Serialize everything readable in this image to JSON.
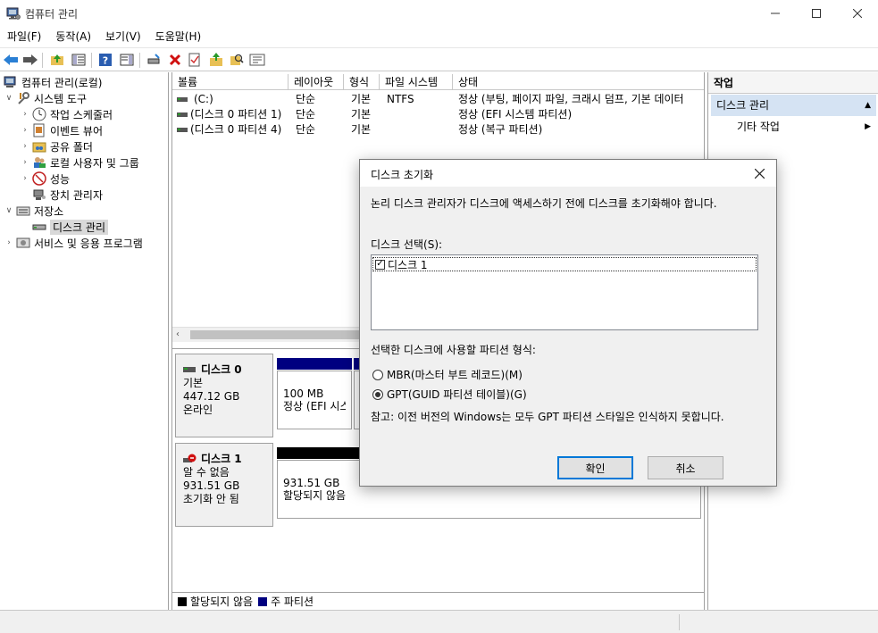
{
  "window": {
    "title": "컴퓨터 관리"
  },
  "menu": [
    "파일(F)",
    "동작(A)",
    "보기(V)",
    "도움말(H)"
  ],
  "tree": {
    "root": "컴퓨터 관리(로컬)",
    "system_tools": "시스템 도구",
    "task_scheduler": "작업 스케줄러",
    "event_viewer": "이벤트 뷰어",
    "shared_folders": "공유 폴더",
    "local_users": "로컬 사용자 및 그룹",
    "performance": "성능",
    "device_manager": "장치 관리자",
    "storage": "저장소",
    "disk_management": "디스크 관리",
    "services": "서비스 및 응용 프로그램"
  },
  "volume_table": {
    "headers": [
      "볼륨",
      "레이아웃",
      "형식",
      "파일 시스템",
      "상태"
    ],
    "rows": [
      [
        "(C:)",
        "단순",
        "기본",
        "NTFS",
        "정상 (부팅, 페이지 파일, 크래시 덤프, 기본 데이터"
      ],
      [
        "(디스크 0 파티션 1)",
        "단순",
        "기본",
        "",
        "정상 (EFI 시스템 파티션)"
      ],
      [
        "(디스크 0 파티션 4)",
        "단순",
        "기본",
        "",
        "정상 (복구 파티션)"
      ]
    ]
  },
  "disks": {
    "disk0": {
      "name": "디스크 0",
      "type": "기본",
      "size": "447.12 GB",
      "status": "온라인",
      "part_size": "100 MB",
      "part_status": "정상 (EFI 시스"
    },
    "disk1": {
      "name": "디스크 1",
      "type": "알 수 없음",
      "size": "931.51 GB",
      "status": "초기화 안 됨",
      "part_size": "931.51 GB",
      "part_status": "할당되지 않음"
    }
  },
  "legend": {
    "unallocated": "할당되지 않음",
    "primary": "주 파티션"
  },
  "actions": {
    "header": "작업",
    "section": "디스크 관리",
    "more": "기타 작업"
  },
  "dialog": {
    "title": "디스크 초기화",
    "intro": "논리 디스크 관리자가 디스크에 액세스하기 전에 디스크를 초기화해야 합니다.",
    "select_label": "디스크 선택(S):",
    "disk_item": "디스크 1",
    "partition_style_label": "선택한 디스크에 사용할 파티션 형식:",
    "mbr_option": "MBR(마스터 부트 레코드)(M)",
    "gpt_option": "GPT(GUID 파티션 테이블)(G)",
    "note": "참고: 이전 버전의 Windows는 모두 GPT 파티션 스타일은 인식하지 못합니다.",
    "ok": "확인",
    "cancel": "취소"
  },
  "colors": {
    "primary_partition": "#000080",
    "unallocated": "#000000",
    "accent": "#0078d7"
  }
}
